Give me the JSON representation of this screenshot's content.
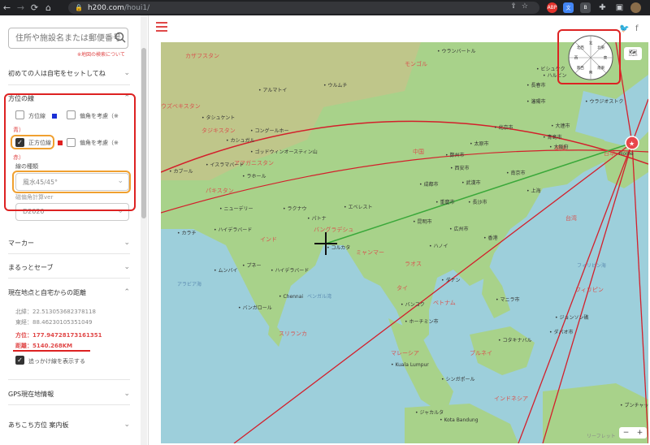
{
  "browser": {
    "url_host": "h200.com",
    "url_path": "/houi1/"
  },
  "sidebar": {
    "search_placeholder": "住所や施設名または郵便番号",
    "search_note": "※地図の検索について",
    "intro_label": "初めての人は自宅をセットしてね",
    "direction_lines": {
      "title": "方位の線",
      "row1": {
        "label": "方位線",
        "color": "#1a2fd6",
        "declination_label": "偏角を考慮（※",
        "suffix": "青）"
      },
      "row2": {
        "label": "正方位線",
        "color": "#e02020",
        "declination_label": "偏角を考慮（※",
        "suffix": "赤）",
        "checked": true
      },
      "line_type_label": "線の種類",
      "line_type_value": "風水45/45°"
    },
    "dataset_label": "磁偏角計算ver",
    "dataset_value": "D2020",
    "marker_label": "マーカー",
    "marutto_label": "まるっとセーブ",
    "distance_section": {
      "title": "現在地点と自宅からの距離",
      "north_lat": "北緯：22.513053682378118",
      "east_lon": "東経：88.46230105351049",
      "bearing": "方位：177.94728173161351",
      "distance": "距離：5140.268KM",
      "tracking_label": "追っかけ線を表示する"
    },
    "gps_label": "GPS現在地情報",
    "guide_label": "あちこち方位 案内板"
  },
  "map": {
    "home_label": "Home",
    "labels": [
      {
        "text": "カザフスタン",
        "cls": "country"
      },
      {
        "text": "ウランバートル",
        "cls": ""
      },
      {
        "text": "モンゴル",
        "cls": "country"
      },
      {
        "text": "ビシュケク",
        "cls": ""
      },
      {
        "text": "アルマトイ",
        "cls": ""
      },
      {
        "text": "ウルムチ",
        "cls": ""
      },
      {
        "text": "長春市",
        "cls": ""
      },
      {
        "text": "ハルビン",
        "cls": ""
      },
      {
        "text": "瀋陽市",
        "cls": ""
      },
      {
        "text": "ウラジオストク",
        "cls": ""
      },
      {
        "text": "ウズベキスタン",
        "cls": "country"
      },
      {
        "text": "タシュケント",
        "cls": ""
      },
      {
        "text": "タジキスタン",
        "cls": "country"
      },
      {
        "text": "北京市",
        "cls": ""
      },
      {
        "text": "大連市",
        "cls": ""
      },
      {
        "text": "太原市",
        "cls": ""
      },
      {
        "text": "青島市",
        "cls": ""
      },
      {
        "text": "韓国",
        "cls": "country"
      },
      {
        "text": "コングールホー",
        "cls": ""
      },
      {
        "text": "カシュガル",
        "cls": ""
      },
      {
        "text": "ゴッドウィンオースティン山",
        "cls": ""
      },
      {
        "text": "中国",
        "cls": "country"
      },
      {
        "text": "鄭州市",
        "cls": ""
      },
      {
        "text": "西安市",
        "cls": ""
      },
      {
        "text": "南京市",
        "cls": ""
      },
      {
        "text": "大阪府",
        "cls": ""
      },
      {
        "text": "日本",
        "cls": "country"
      },
      {
        "text": "アフガニスタン",
        "cls": "country"
      },
      {
        "text": "イスラマバード",
        "cls": ""
      },
      {
        "text": "カブール",
        "cls": ""
      },
      {
        "text": "ラホール",
        "cls": ""
      },
      {
        "text": "パキスタン",
        "cls": "country"
      },
      {
        "text": "成都市",
        "cls": ""
      },
      {
        "text": "武漢市",
        "cls": ""
      },
      {
        "text": "上海",
        "cls": ""
      },
      {
        "text": "ニューデリー",
        "cls": ""
      },
      {
        "text": "ラクナウ",
        "cls": ""
      },
      {
        "text": "エベレスト",
        "cls": ""
      },
      {
        "text": "パトナ",
        "cls": ""
      },
      {
        "text": "重慶市",
        "cls": ""
      },
      {
        "text": "長沙市",
        "cls": ""
      },
      {
        "text": "カラチ",
        "cls": ""
      },
      {
        "text": "ハイデラバード",
        "cls": ""
      },
      {
        "text": "インド",
        "cls": "country"
      },
      {
        "text": "バングラデシュ",
        "cls": "country"
      },
      {
        "text": "昆明市",
        "cls": ""
      },
      {
        "text": "コルカタ",
        "cls": ""
      },
      {
        "text": "広州市",
        "cls": ""
      },
      {
        "text": "香港",
        "cls": ""
      },
      {
        "text": "台湾",
        "cls": "country"
      },
      {
        "text": "ミャンマー",
        "cls": "country"
      },
      {
        "text": "ハノイ",
        "cls": ""
      },
      {
        "text": "ムンバイ",
        "cls": ""
      },
      {
        "text": "プネー",
        "cls": ""
      },
      {
        "text": "ハイデラバード",
        "cls": ""
      },
      {
        "text": "ラオス",
        "cls": "country"
      },
      {
        "text": "フィリピン海",
        "cls": "water"
      },
      {
        "text": "アラビア海",
        "cls": "water"
      },
      {
        "text": "ダナン",
        "cls": ""
      },
      {
        "text": "マニラ市",
        "cls": ""
      },
      {
        "text": "バンガロール",
        "cls": ""
      },
      {
        "text": "Chennai",
        "cls": ""
      },
      {
        "text": "ベンガル湾",
        "cls": "water"
      },
      {
        "text": "タイ",
        "cls": "country"
      },
      {
        "text": "バンコク",
        "cls": ""
      },
      {
        "text": "ベトナム",
        "cls": "country"
      },
      {
        "text": "フィリピン",
        "cls": "country"
      },
      {
        "text": "ジョンソン礁",
        "cls": ""
      },
      {
        "text": "スリランカ",
        "cls": "country"
      },
      {
        "text": "ホーチミン市",
        "cls": ""
      },
      {
        "text": "ダバオ市",
        "cls": ""
      },
      {
        "text": "コタキナバル",
        "cls": ""
      },
      {
        "text": "ブルネイ",
        "cls": "country"
      },
      {
        "text": "マレーシア",
        "cls": "country"
      },
      {
        "text": "Kuala Lumpur",
        "cls": ""
      },
      {
        "text": "シンガポール",
        "cls": ""
      },
      {
        "text": "インドネシア",
        "cls": "country"
      },
      {
        "text": "ジャカルタ",
        "cls": ""
      },
      {
        "text": "Kota Bandung",
        "cls": ""
      },
      {
        "text": "ブンチャック",
        "cls": ""
      }
    ],
    "credit": "リーフレット",
    "zoom_minus": "−",
    "zoom_plus": "+"
  },
  "compass_sectors": [
    "北",
    "北東",
    "東",
    "南東",
    "南",
    "南西",
    "西",
    "北西"
  ],
  "colors": {
    "accent": "#e04848",
    "home_marker": "#e8454a",
    "line_red": "#d31f2b",
    "line_green": "#3aa83a",
    "map_sea": "#9dcfdb",
    "map_land": "#a8d28a"
  }
}
